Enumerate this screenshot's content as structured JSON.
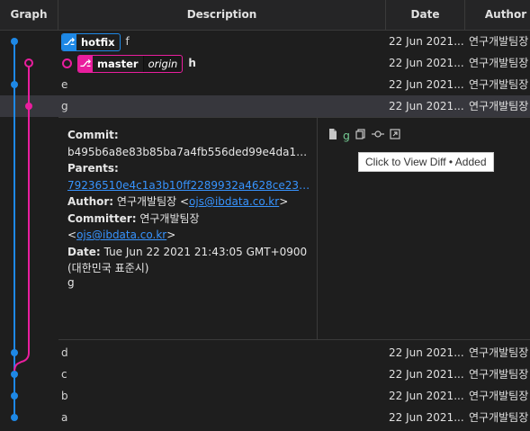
{
  "columns": {
    "graph": "Graph",
    "description": "Description",
    "date": "Date",
    "author": "Author"
  },
  "colors": {
    "branch_blue": "#1e88e5",
    "branch_magenta": "#e91e9e",
    "link": "#3794ff",
    "added_file": "#73c991"
  },
  "rows_top": [
    {
      "labels": [
        {
          "name": "hotfix",
          "icon": "branch-icon"
        }
      ],
      "message": "f",
      "date": "22 Jun 2021...",
      "author": "연구개발팀장"
    },
    {
      "labels": [
        {
          "name": "master",
          "remote": "origin",
          "icon": "branch-icon"
        }
      ],
      "head": true,
      "message": "h",
      "date": "22 Jun 2021...",
      "author": "연구개발팀장"
    },
    {
      "message": "e",
      "date": "22 Jun 2021...",
      "author": "연구개발팀장"
    },
    {
      "message": "g",
      "date": "22 Jun 2021...",
      "author": "연구개발팀장",
      "selected": true
    }
  ],
  "details": {
    "commit_label": "Commit:",
    "commit_hash": "b495b6a8e83b85ba7a4fb556ded99e4da1a8...",
    "parents_label": "Parents:",
    "parent_hash": "79236510e4c1a3b10ff2289932a4628ce23ed...",
    "author_label": "Author:",
    "author_name": "연구개발팀장",
    "author_email": "ojs@ibdata.co.kr",
    "committer_label": "Committer:",
    "committer_name": "연구개발팀장",
    "committer_email": "ojs@ibdata.co.kr",
    "date_label": "Date:",
    "date_value": "Tue Jun 22 2021 21:43:05 GMT+0900",
    "timezone": "(대한민국 표준시)",
    "body": "g",
    "file": {
      "name": "g",
      "status": "Added"
    },
    "tooltip": "Click to View Diff • Added"
  },
  "rows_bottom": [
    {
      "message": "d",
      "date": "22 Jun 2021...",
      "author": "연구개발팀장"
    },
    {
      "message": "c",
      "date": "22 Jun 2021...",
      "author": "연구개발팀장"
    },
    {
      "message": "b",
      "date": "22 Jun 2021...",
      "author": "연구개발팀장"
    },
    {
      "message": "a",
      "date": "22 Jun 2021...",
      "author": "연구개발팀장"
    }
  ]
}
